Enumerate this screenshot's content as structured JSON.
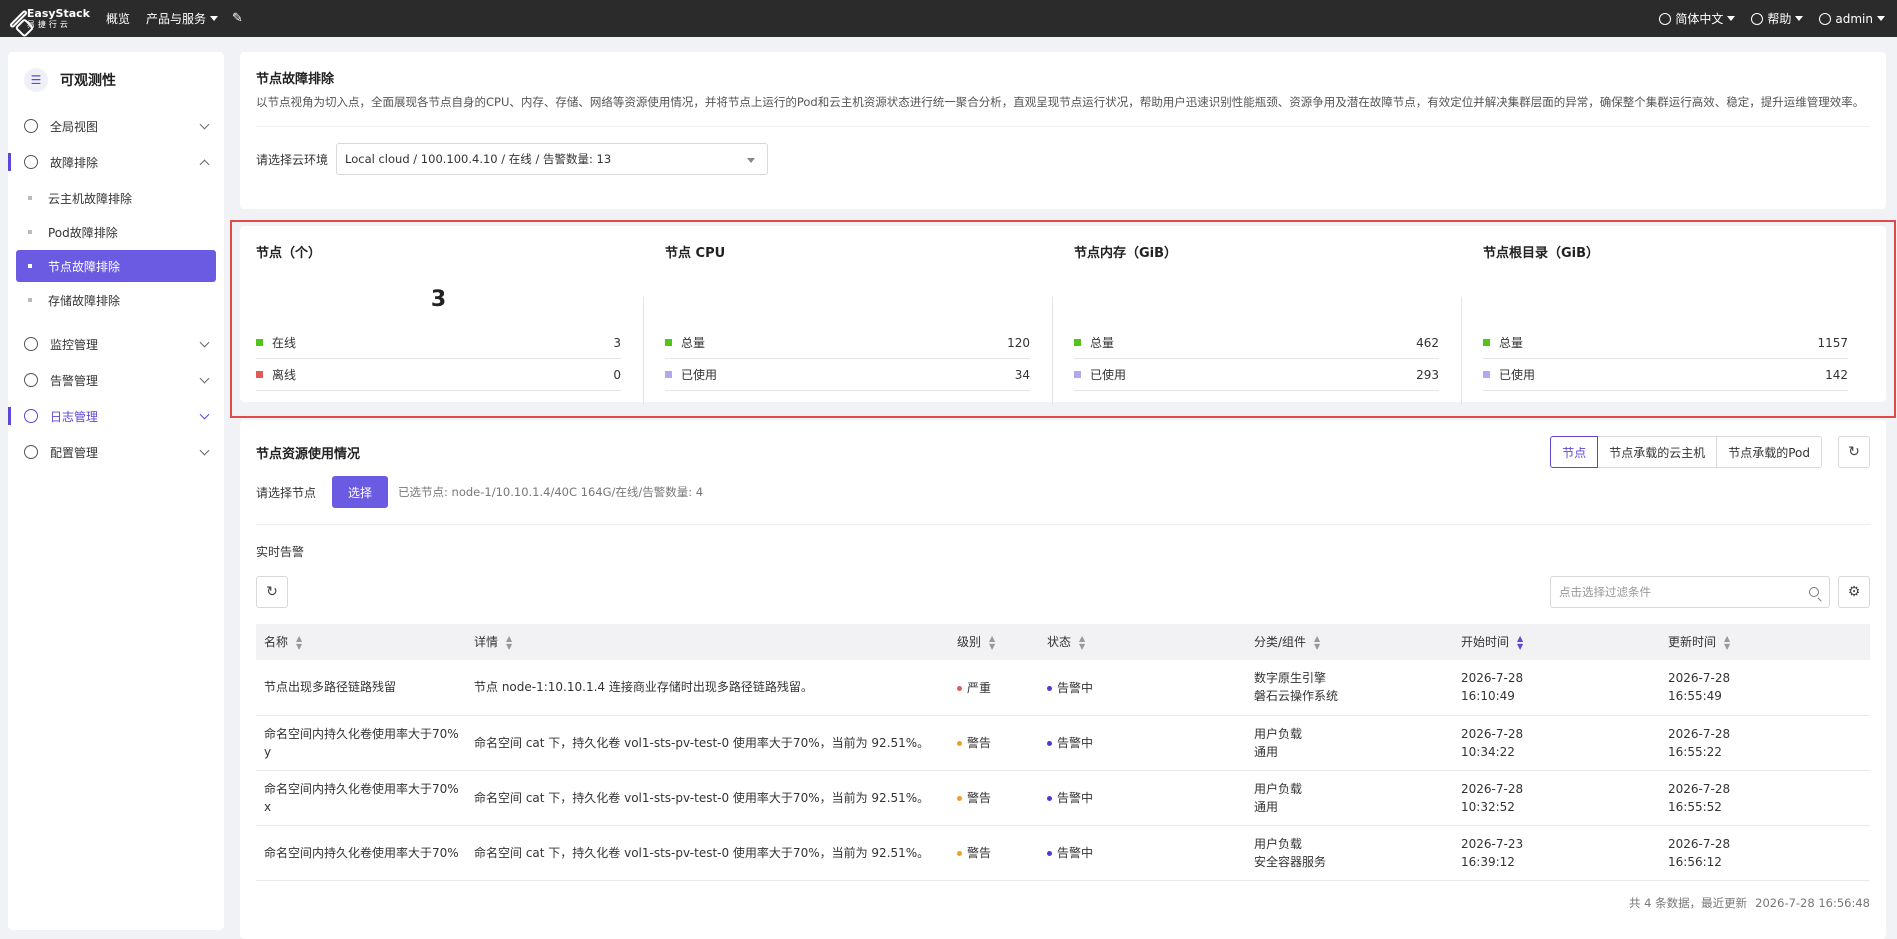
{
  "topbar": {
    "logo_en": "EasyStack",
    "logo_cn": "易捷行云",
    "nav": [
      "概览",
      "产品与服务"
    ],
    "language": "简体中文",
    "help": "帮助",
    "user": "admin"
  },
  "sidebar": {
    "title": "可观测性",
    "items": [
      {
        "label": "全局视图"
      },
      {
        "label": "故障排除"
      },
      {
        "label": "监控管理"
      },
      {
        "label": "告警管理"
      },
      {
        "label": "日志管理"
      },
      {
        "label": "配置管理"
      }
    ],
    "sub_items": [
      "云主机故障排除",
      "Pod故障排除",
      "节点故障排除",
      "存储故障排除"
    ]
  },
  "intro": {
    "title": "节点故障排除",
    "description": "以节点视角为切入点，全面展现各节点自身的CPU、内存、存储、网络等资源使用情况，并将节点上运行的Pod和云主机资源状态进行统一聚合分析，直观呈现节点运行状况，帮助用户迅速识别性能瓶颈、资源争用及潜在故障节点，有效定位并解决集群层面的异常，确保整个集群运行高效、稳定，提升运维管理效率。",
    "env_label": "请选择云环境",
    "env_value": "Local cloud / 100.100.4.10 / 在线 / 告警数量: 13"
  },
  "stats": [
    {
      "title": "节点（个）",
      "big": "3",
      "rows": [
        {
          "label": "在线",
          "value": "3",
          "color": "#52c41a"
        },
        {
          "label": "离线",
          "value": "0",
          "color": "#e05a5a"
        }
      ]
    },
    {
      "title": "节点 CPU",
      "rows": [
        {
          "label": "总量",
          "value": "120",
          "color": "#52c41a"
        },
        {
          "label": "已使用",
          "value": "34",
          "color": "#b3a8f0"
        }
      ]
    },
    {
      "title": "节点内存（GiB）",
      "rows": [
        {
          "label": "总量",
          "value": "462",
          "color": "#52c41a"
        },
        {
          "label": "已使用",
          "value": "293",
          "color": "#b3a8f0"
        }
      ]
    },
    {
      "title": "节点根目录（GiB）",
      "rows": [
        {
          "label": "总量",
          "value": "1157",
          "color": "#52c41a"
        },
        {
          "label": "已使用",
          "value": "142",
          "color": "#b3a8f0"
        }
      ]
    }
  ],
  "resources": {
    "title": "节点资源使用情况",
    "tabs": [
      "节点",
      "节点承载的云主机",
      "节点承载的Pod"
    ],
    "node_label": "请选择节点",
    "select_button": "选择",
    "selected_node": "已选节点:  node-1/10.10.1.4/40C 164G/在线/告警数量: 4",
    "alerts_title": "实时告警",
    "search_placeholder": "点击选择过滤条件",
    "columns": [
      "名称",
      "详情",
      "级别",
      "状态",
      "分类/组件",
      "开始时间",
      "更新时间"
    ],
    "rows": [
      {
        "name": "节点出现多路径链路残留",
        "detail": "节点 node-1:10.10.1.4 连接商业存储时出现多路径链路残留。",
        "level": "严重",
        "level_color": "#e05a5a",
        "status": "告警中",
        "status_color": "#4b3bd4",
        "cat1": "数字原生引擎",
        "cat2": "磐石云操作系统",
        "start1": "2026-7-28",
        "start2": "16:10:49",
        "upd1": "2026-7-28",
        "upd2": "16:55:49"
      },
      {
        "name": "命名空间内持久化卷使用率大于70% y",
        "detail": "命名空间 cat 下，持久化卷 vol1-sts-pv-test-0 使用率大于70%，当前为 92.51%。",
        "level": "警告",
        "level_color": "#f0a020",
        "status": "告警中",
        "status_color": "#4b3bd4",
        "cat1": "用户负载",
        "cat2": "通用",
        "start1": "2026-7-28",
        "start2": "10:34:22",
        "upd1": "2026-7-28",
        "upd2": "16:55:22"
      },
      {
        "name": "命名空间内持久化卷使用率大于70% x",
        "detail": "命名空间 cat 下，持久化卷 vol1-sts-pv-test-0 使用率大于70%，当前为 92.51%。",
        "level": "警告",
        "level_color": "#f0a020",
        "status": "告警中",
        "status_color": "#4b3bd4",
        "cat1": "用户负载",
        "cat2": "通用",
        "start1": "2026-7-28",
        "start2": "10:32:52",
        "upd1": "2026-7-28",
        "upd2": "16:55:52"
      },
      {
        "name": "命名空间内持久化卷使用率大于70%",
        "detail": "命名空间 cat 下，持久化卷 vol1-sts-pv-test-0 使用率大于70%，当前为 92.51%。",
        "level": "警告",
        "level_color": "#f0a020",
        "status": "告警中",
        "status_color": "#4b3bd4",
        "cat1": "用户负载",
        "cat2": "安全容器服务",
        "start1": "2026-7-23",
        "start2": "16:39:12",
        "upd1": "2026-7-28",
        "upd2": "16:56:12"
      }
    ],
    "footer_count": "共 4 条数据，最近更新",
    "footer_time": "2026-7-28 16:56:48"
  },
  "colors": {
    "accent": "#6b5be2",
    "highlight_border": "#e04a4a"
  }
}
